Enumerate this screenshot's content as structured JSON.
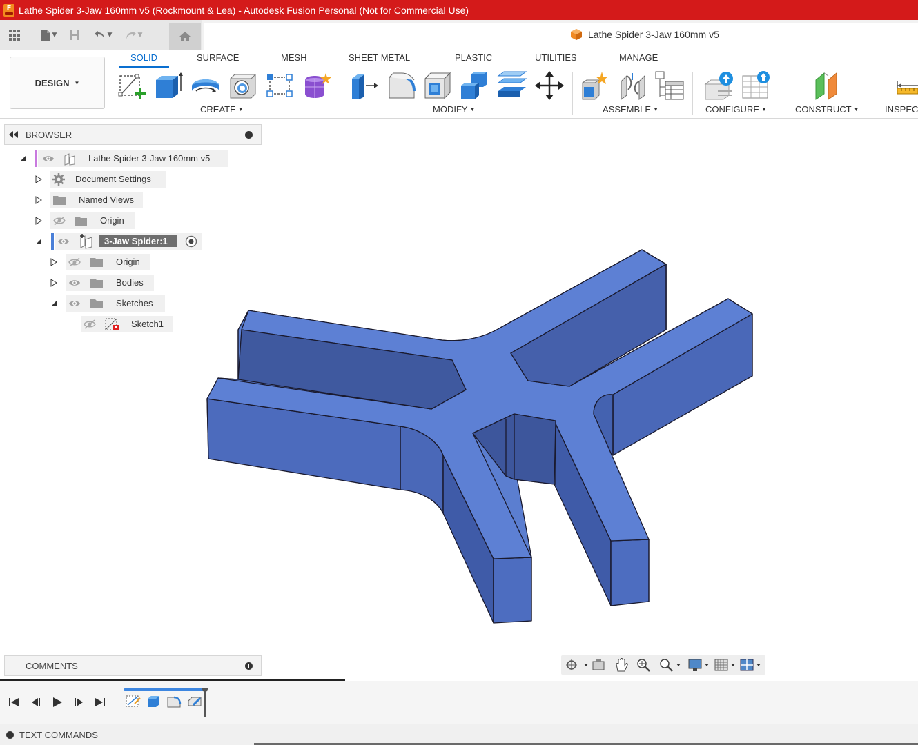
{
  "window": {
    "title": "Lathe Spider 3-Jaw 160mm v5 (Rockmount & Lea) - Autodesk Fusion Personal (Not for Commercial Use)",
    "logo_letter": "F"
  },
  "document_tab": {
    "label": "Lathe Spider 3-Jaw 160mm v5"
  },
  "workspace": {
    "label": "DESIGN"
  },
  "ribbon": {
    "tabs": [
      "SOLID",
      "SURFACE",
      "MESH",
      "SHEET METAL",
      "PLASTIC",
      "UTILITIES",
      "MANAGE"
    ],
    "active_tab": "SOLID",
    "groups": [
      "CREATE",
      "MODIFY",
      "ASSEMBLE",
      "CONFIGURE",
      "CONSTRUCT",
      "INSPEC"
    ]
  },
  "browser": {
    "title": "BROWSER",
    "items": [
      {
        "label": "Lathe Spider 3-Jaw 160mm v5"
      },
      {
        "label": "Document Settings"
      },
      {
        "label": "Named Views"
      },
      {
        "label": "Origin"
      },
      {
        "label": "3-Jaw Spider:1"
      },
      {
        "label": "Origin"
      },
      {
        "label": "Bodies"
      },
      {
        "label": "Sketches"
      },
      {
        "label": "Sketch1"
      }
    ]
  },
  "comments": {
    "title": "COMMENTS"
  },
  "text_commands": {
    "label": "TEXT COMMANDS"
  },
  "colors": {
    "title_bar": "#d41a1a",
    "accent": "#0a6fd0",
    "body_top": "#5b7ed0",
    "body_side": "#4765b8"
  }
}
